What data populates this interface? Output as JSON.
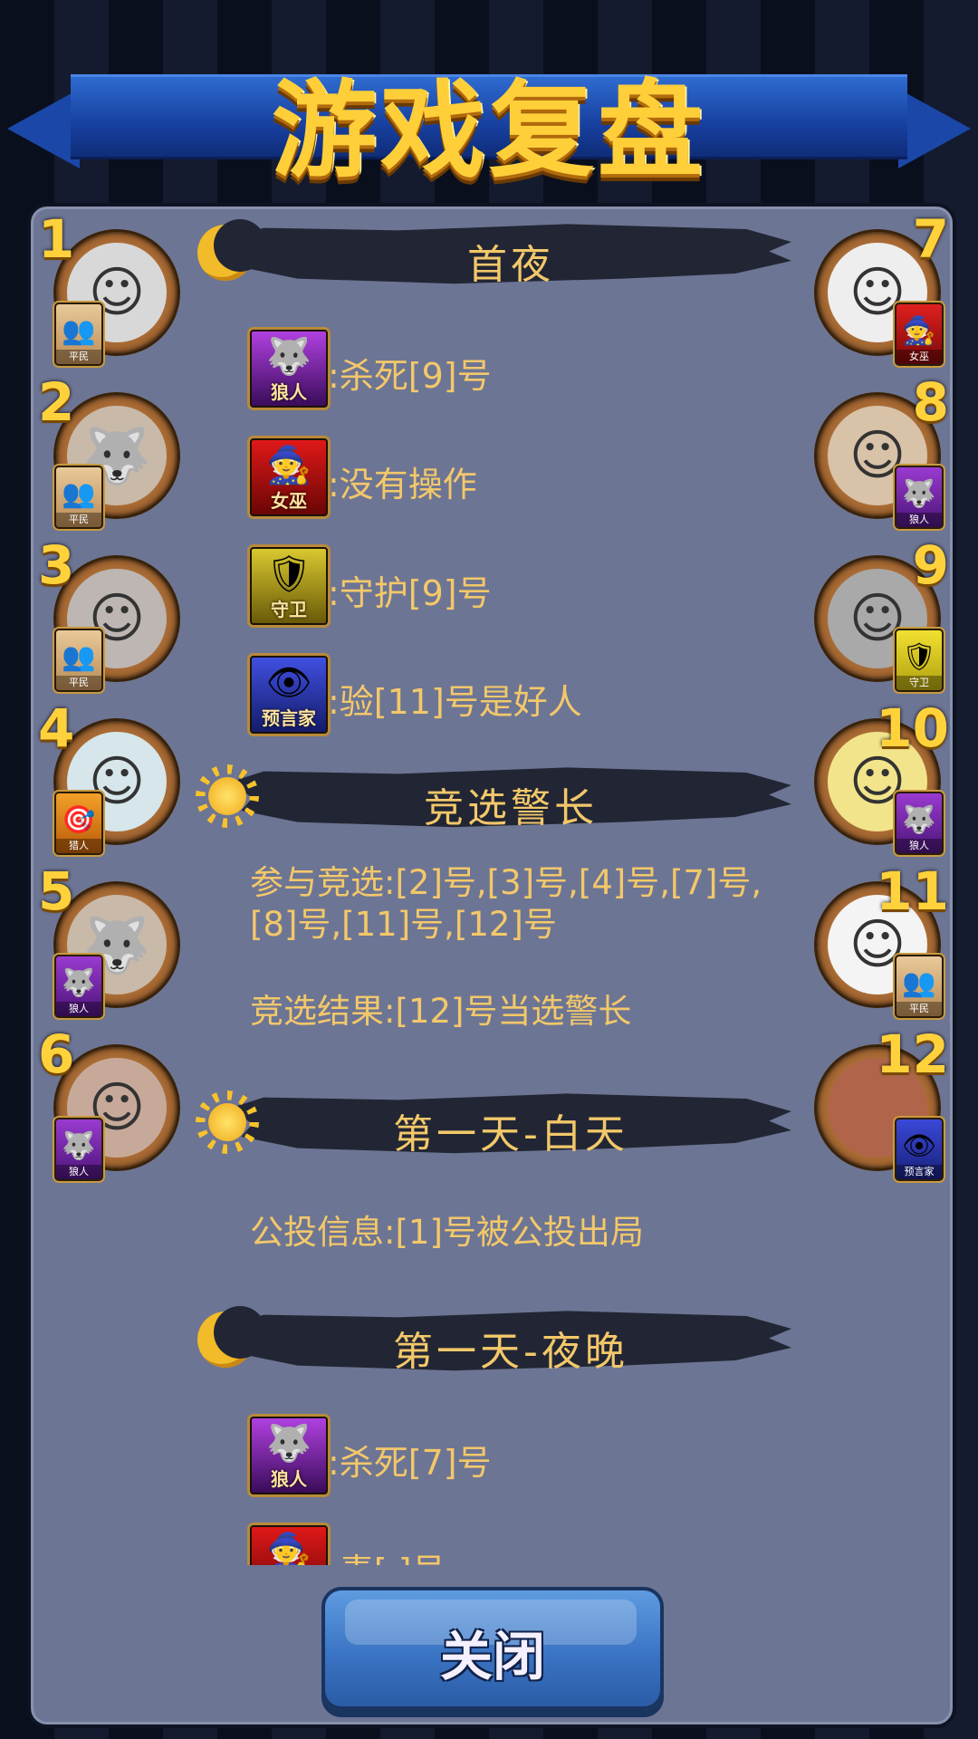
{
  "title": "游戏复盘",
  "close_label": "关闭",
  "colors": {
    "accent_gold": "#f3c86a",
    "panel": "#6d7594",
    "button": "#3a74c4"
  },
  "players_left": [
    {
      "number": "1",
      "role": "平民",
      "role_icon": "villager-icon"
    },
    {
      "number": "2",
      "role": "平民",
      "role_icon": "villager-icon"
    },
    {
      "number": "3",
      "role": "平民",
      "role_icon": "villager-icon"
    },
    {
      "number": "4",
      "role": "猎人",
      "role_icon": "hunter-icon"
    },
    {
      "number": "5",
      "role": "狼人",
      "role_icon": "werewolf-icon"
    },
    {
      "number": "6",
      "role": "狼人",
      "role_icon": "werewolf-icon"
    }
  ],
  "players_right": [
    {
      "number": "7",
      "role": "女巫",
      "role_icon": "witch-icon"
    },
    {
      "number": "8",
      "role": "狼人",
      "role_icon": "werewolf-icon"
    },
    {
      "number": "9",
      "role": "守卫",
      "role_icon": "guard-icon"
    },
    {
      "number": "10",
      "role": "狼人",
      "role_icon": "werewolf-icon"
    },
    {
      "number": "11",
      "role": "平民",
      "role_icon": "villager-icon"
    },
    {
      "number": "12",
      "role": "预言家",
      "role_icon": "seer-icon"
    }
  ],
  "log": {
    "first_night": {
      "heading": "首夜",
      "actions": [
        {
          "role": "狼人",
          "text": ":杀死[9]号"
        },
        {
          "role": "女巫",
          "text": ":没有操作"
        },
        {
          "role": "守卫",
          "text": ":守护[9]号"
        },
        {
          "role": "预言家",
          "text": ":验[11]号是好人"
        }
      ]
    },
    "sheriff": {
      "heading": "竞选警长",
      "participants": "参与竞选:[2]号,[3]号,[4]号,[7]号,[8]号,[11]号,[12]号",
      "result": "竞选结果:[12]号当选警长"
    },
    "day1": {
      "heading": "第一天-白天",
      "vote": "公投信息:[1]号被公投出局"
    },
    "night1": {
      "heading": "第一天-夜晚",
      "actions": [
        {
          "role": "狼人",
          "text": ":杀死[7]号"
        },
        {
          "role": "女巫",
          "text": ":毒[ ]号"
        }
      ]
    }
  }
}
